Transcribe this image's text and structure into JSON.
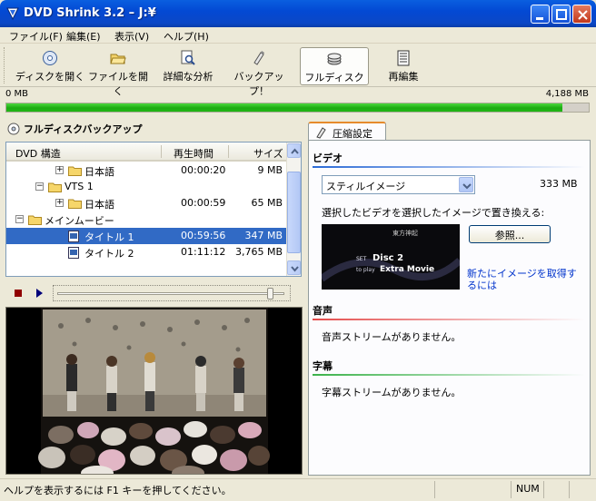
{
  "window": {
    "title": "DVD Shrink 3.2 – J:¥"
  },
  "menu": [
    "ファイル(F)",
    "編集(E)",
    "表示(V)",
    "ヘルプ(H)"
  ],
  "toolbar": {
    "open_disc": "ディスクを開く",
    "open_files": "ファイルを開く",
    "analyze": "詳細な分析",
    "backup": "バックアップ！",
    "full_disc": "フルディスク",
    "reauthor": "再編集"
  },
  "progress": {
    "left_label": "0 MB",
    "right_label": "4,188 MB",
    "fraction": 0.955
  },
  "left": {
    "section_title": "フルディスクバックアップ",
    "columns": {
      "structure": "DVD 構造",
      "time": "再生時間",
      "size": "サイズ"
    },
    "rows": [
      {
        "name": "日本語",
        "time": "00:00:20",
        "size": "9 MB",
        "indent": 2,
        "expander": "+",
        "icon": "folder"
      },
      {
        "name": "VTS 1",
        "time": "",
        "size": "",
        "indent": 1,
        "expander": "-",
        "icon": "folder"
      },
      {
        "name": "日本語",
        "time": "00:00:59",
        "size": "65 MB",
        "indent": 2,
        "expander": "+",
        "icon": "folder"
      },
      {
        "name": "メインムービー",
        "time": "",
        "size": "",
        "indent": 0,
        "expander": "-",
        "icon": "folder"
      },
      {
        "name": "タイトル 1",
        "time": "00:59:56",
        "size": "347 MB",
        "indent": 2,
        "expander": "",
        "icon": "title",
        "selected": true
      },
      {
        "name": "タイトル 2",
        "time": "01:11:12",
        "size": "3,765 MB",
        "indent": 2,
        "expander": "",
        "icon": "title"
      }
    ],
    "seek_fraction": 0.95
  },
  "right": {
    "tab_label": "圧縮設定",
    "video_head": "ビデオ",
    "video_mode": "スティルイメージ",
    "video_size": "333 MB",
    "replace_text": "選択したビデオを選択したイメージで置き換える:",
    "browse_label": "参照...",
    "thumb_text_1": "Disc 2",
    "thumb_text_2": "Extra Movie",
    "thumb_text_3": "SET",
    "thumb_text_4": "to play",
    "thumb_text_5": "東方神起",
    "link_text": "新たにイメージを取得するには",
    "audio_head": "音声",
    "audio_text": "音声ストリームがありません。",
    "subtitle_head": "字幕",
    "subtitle_text": "字幕ストリームがありません。"
  },
  "status": {
    "message": "ヘルプを表示するには F1 キーを押してください。",
    "num": "NUM"
  }
}
